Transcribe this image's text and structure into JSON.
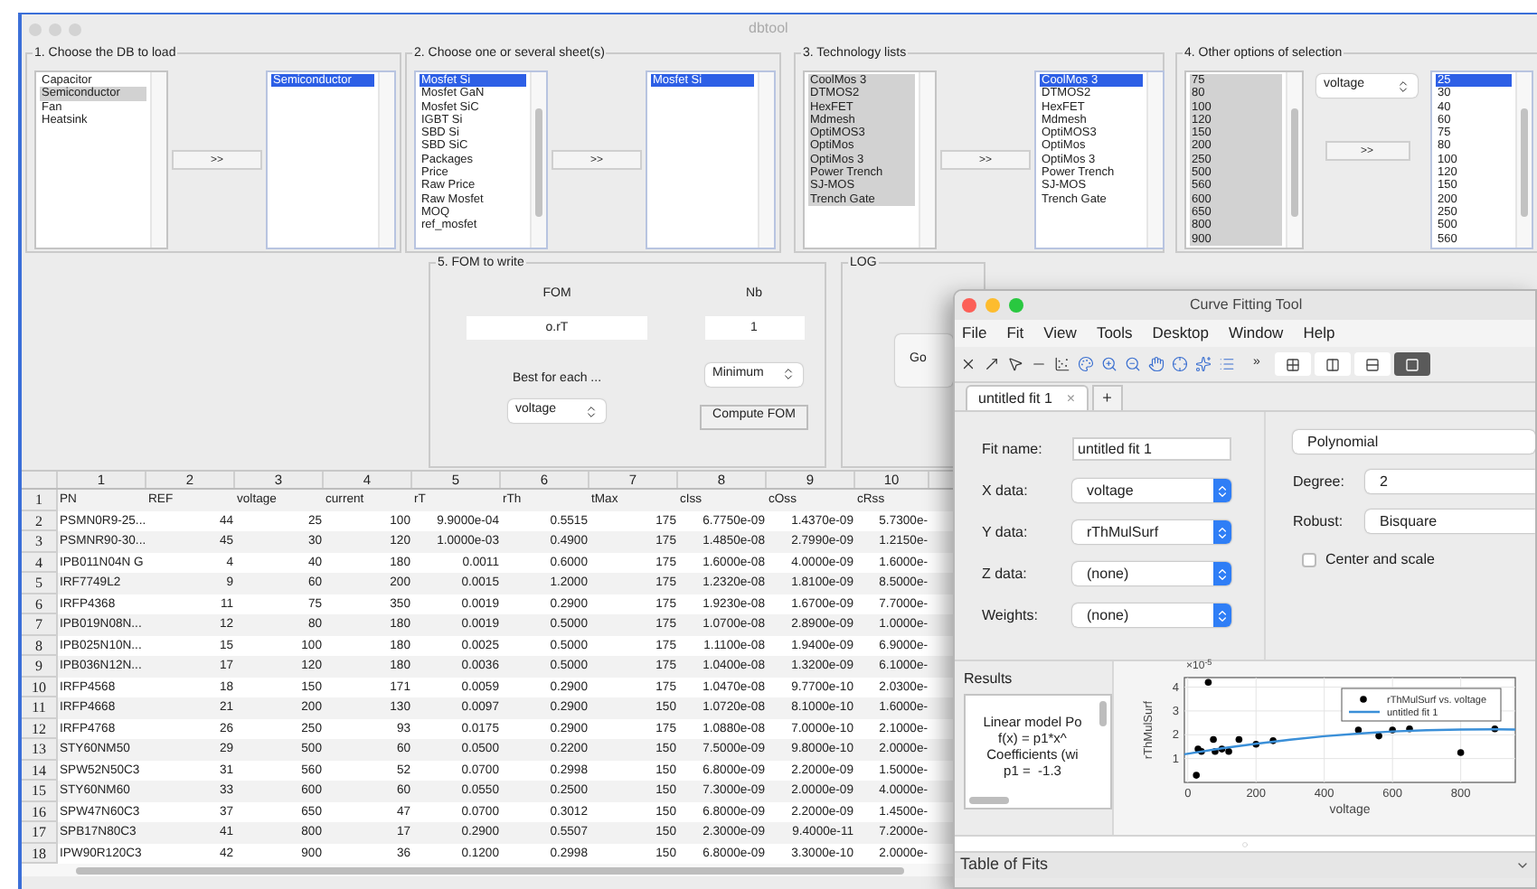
{
  "main_window": {
    "title": "dbtool"
  },
  "panels": [
    {
      "title": "1. Choose the DB to load",
      "move_button": ">>",
      "source": {
        "active": false,
        "items": [
          {
            "label": "Capacitor",
            "selected": false
          },
          {
            "label": "Semiconductor",
            "selected": true
          },
          {
            "label": "Fan",
            "selected": false
          },
          {
            "label": "Heatsink",
            "selected": false
          }
        ]
      },
      "target": {
        "active": true,
        "items": [
          {
            "label": "Semiconductor",
            "selected": true
          }
        ]
      }
    },
    {
      "title": "2. Choose one or several sheet(s)",
      "move_button": ">>",
      "source": {
        "active": true,
        "items": [
          {
            "label": "Mosfet Si",
            "selected": true
          },
          {
            "label": "Mosfet GaN",
            "selected": false
          },
          {
            "label": "Mosfet SiC",
            "selected": false
          },
          {
            "label": "IGBT Si",
            "selected": false
          },
          {
            "label": "SBD Si",
            "selected": false
          },
          {
            "label": "SBD SiC",
            "selected": false
          },
          {
            "label": "Packages",
            "selected": false
          },
          {
            "label": "Price",
            "selected": false
          },
          {
            "label": "Raw Price",
            "selected": false
          },
          {
            "label": "Raw Mosfet",
            "selected": false
          },
          {
            "label": "MOQ",
            "selected": false
          },
          {
            "label": "ref_mosfet",
            "selected": false
          }
        ]
      },
      "target": {
        "active": true,
        "items": [
          {
            "label": "Mosfet Si",
            "selected": true
          }
        ]
      }
    },
    {
      "title": "3. Technology lists",
      "move_button": ">>",
      "source": {
        "active": false,
        "items": [
          {
            "label": "CoolMos 3",
            "selected": true
          },
          {
            "label": "DTMOS2",
            "selected": true
          },
          {
            "label": "HexFET",
            "selected": true
          },
          {
            "label": "Mdmesh",
            "selected": true
          },
          {
            "label": "OptiMOS3",
            "selected": true
          },
          {
            "label": "OptiMos",
            "selected": true
          },
          {
            "label": "OptiMos 3",
            "selected": true
          },
          {
            "label": "Power Trench",
            "selected": true
          },
          {
            "label": "SJ-MOS",
            "selected": true
          },
          {
            "label": "Trench Gate",
            "selected": true
          }
        ]
      },
      "target": {
        "active": true,
        "items": [
          {
            "label": "CoolMos 3",
            "selected": true
          },
          {
            "label": "DTMOS2",
            "selected": false
          },
          {
            "label": "HexFET",
            "selected": false
          },
          {
            "label": "Mdmesh",
            "selected": false
          },
          {
            "label": "OptiMOS3",
            "selected": false
          },
          {
            "label": "OptiMos",
            "selected": false
          },
          {
            "label": "OptiMos 3",
            "selected": false
          },
          {
            "label": "Power Trench",
            "selected": false
          },
          {
            "label": "SJ-MOS",
            "selected": false
          },
          {
            "label": "Trench Gate",
            "selected": false
          }
        ]
      }
    },
    {
      "title": "4. Other options of selection",
      "move_button": ">>",
      "popup": "voltage",
      "source": {
        "active": false,
        "items": [
          {
            "label": "75",
            "selected": true
          },
          {
            "label": "80",
            "selected": true
          },
          {
            "label": "100",
            "selected": true
          },
          {
            "label": "120",
            "selected": true
          },
          {
            "label": "150",
            "selected": true
          },
          {
            "label": "200",
            "selected": true
          },
          {
            "label": "250",
            "selected": true
          },
          {
            "label": "500",
            "selected": true
          },
          {
            "label": "560",
            "selected": true
          },
          {
            "label": "600",
            "selected": true
          },
          {
            "label": "650",
            "selected": true
          },
          {
            "label": "800",
            "selected": true
          },
          {
            "label": "900",
            "selected": true
          }
        ]
      },
      "target": {
        "active": true,
        "items": [
          {
            "label": "25",
            "selected": true
          },
          {
            "label": "30",
            "selected": false
          },
          {
            "label": "40",
            "selected": false
          },
          {
            "label": "60",
            "selected": false
          },
          {
            "label": "75",
            "selected": false
          },
          {
            "label": "80",
            "selected": false
          },
          {
            "label": "100",
            "selected": false
          },
          {
            "label": "120",
            "selected": false
          },
          {
            "label": "150",
            "selected": false
          },
          {
            "label": "200",
            "selected": false
          },
          {
            "label": "250",
            "selected": false
          },
          {
            "label": "500",
            "selected": false
          },
          {
            "label": "560",
            "selected": false
          }
        ]
      }
    }
  ],
  "fom_panel": {
    "title": "5. FOM to write",
    "fom_label": "FOM",
    "fom_value": "o.rT",
    "nb_label": "Nb",
    "nb_value": "1",
    "best_label": "Best for each ...",
    "best_popup": "voltage",
    "mode_popup": "Minimum",
    "compute_button": "Compute FOM"
  },
  "log_panel": {
    "title": "LOG",
    "button": "Go"
  },
  "table": {
    "columns": [
      "1",
      "2",
      "3",
      "4",
      "5",
      "6",
      "7",
      "8",
      "9",
      "10"
    ],
    "rows": [
      {
        "num": "1",
        "cells": [
          "PN",
          "REF",
          "voltage",
          "current",
          "rT",
          "rTh",
          "tMax",
          "cIss",
          "cOss",
          "cRss"
        ]
      },
      {
        "num": "2",
        "cells": [
          "PSMN0R9-25...",
          "44",
          "25",
          "100",
          "9.9000e-04",
          "0.5515",
          "175",
          "6.7750e-09",
          "1.4370e-09",
          "5.7300e-"
        ]
      },
      {
        "num": "3",
        "cells": [
          "PSMNR90-30...",
          "45",
          "30",
          "120",
          "1.0000e-03",
          "0.4900",
          "175",
          "1.4850e-08",
          "2.7990e-09",
          "1.2150e-"
        ]
      },
      {
        "num": "4",
        "cells": [
          "IPB011N04N G",
          "4",
          "40",
          "180",
          "0.0011",
          "0.6000",
          "175",
          "1.6000e-08",
          "4.0000e-09",
          "1.6000e-"
        ]
      },
      {
        "num": "5",
        "cells": [
          "IRF7749L2",
          "9",
          "60",
          "200",
          "0.0015",
          "1.2000",
          "175",
          "1.2320e-08",
          "1.8100e-09",
          "8.5000e-"
        ]
      },
      {
        "num": "6",
        "cells": [
          "IRFP4368",
          "11",
          "75",
          "350",
          "0.0019",
          "0.2900",
          "175",
          "1.9230e-08",
          "1.6700e-09",
          "7.7000e-"
        ]
      },
      {
        "num": "7",
        "cells": [
          "IPB019N08N...",
          "12",
          "80",
          "180",
          "0.0019",
          "0.5000",
          "175",
          "1.0700e-08",
          "2.8900e-09",
          "1.0000e-"
        ]
      },
      {
        "num": "8",
        "cells": [
          "IPB025N10N...",
          "15",
          "100",
          "180",
          "0.0025",
          "0.5000",
          "175",
          "1.1100e-08",
          "1.9400e-09",
          "6.9000e-"
        ]
      },
      {
        "num": "9",
        "cells": [
          "IPB036N12N...",
          "17",
          "120",
          "180",
          "0.0036",
          "0.5000",
          "175",
          "1.0400e-08",
          "1.3200e-09",
          "6.1000e-"
        ]
      },
      {
        "num": "10",
        "cells": [
          "IRFP4568",
          "18",
          "150",
          "171",
          "0.0059",
          "0.2900",
          "175",
          "1.0470e-08",
          "9.7700e-10",
          "2.0300e-"
        ]
      },
      {
        "num": "11",
        "cells": [
          "IRFP4668",
          "21",
          "200",
          "130",
          "0.0097",
          "0.2900",
          "150",
          "1.0720e-08",
          "8.1000e-10",
          "1.6000e-"
        ]
      },
      {
        "num": "12",
        "cells": [
          "IRFP4768",
          "26",
          "250",
          "93",
          "0.0175",
          "0.2900",
          "175",
          "1.0880e-08",
          "7.0000e-10",
          "2.1000e-"
        ]
      },
      {
        "num": "13",
        "cells": [
          "STY60NM50",
          "29",
          "500",
          "60",
          "0.0500",
          "0.2200",
          "150",
          "7.5000e-09",
          "9.8000e-10",
          "2.0000e-"
        ]
      },
      {
        "num": "14",
        "cells": [
          "SPW52N50C3",
          "31",
          "560",
          "52",
          "0.0700",
          "0.2998",
          "150",
          "6.8000e-09",
          "2.2000e-09",
          "1.5000e-"
        ]
      },
      {
        "num": "15",
        "cells": [
          "STY60NM60",
          "33",
          "600",
          "60",
          "0.0550",
          "0.2500",
          "150",
          "7.3000e-09",
          "2.0000e-09",
          "4.0000e-"
        ]
      },
      {
        "num": "16",
        "cells": [
          "SPW47N60C3",
          "37",
          "650",
          "47",
          "0.0700",
          "0.3012",
          "150",
          "6.8000e-09",
          "2.2000e-09",
          "1.4500e-"
        ]
      },
      {
        "num": "17",
        "cells": [
          "SPB17N80C3",
          "41",
          "800",
          "17",
          "0.2900",
          "0.5507",
          "150",
          "2.3000e-09",
          "9.4000e-11",
          "7.2000e-"
        ]
      },
      {
        "num": "18",
        "cells": [
          "IPW90R120C3",
          "42",
          "900",
          "36",
          "0.1200",
          "0.2998",
          "150",
          "6.8000e-09",
          "3.3000e-10",
          "2.0000e-"
        ]
      }
    ]
  },
  "cft": {
    "title": "Curve Fitting Tool",
    "menu": [
      "File",
      "Fit",
      "View",
      "Tools",
      "Desktop",
      "Window",
      "Help"
    ],
    "toolbar_more": "»",
    "layout_buttons": [
      {
        "kind": "grid",
        "selected": false
      },
      {
        "kind": "columns",
        "selected": false
      },
      {
        "kind": "rows",
        "selected": false
      },
      {
        "kind": "single",
        "selected": true
      }
    ],
    "tabs": [
      {
        "label": "untitled fit 1",
        "close": "×",
        "selected": true
      }
    ],
    "add_tab": "+",
    "fit_name_label": "Fit name:",
    "fit_name": "untitled fit 1",
    "data_selects": [
      {
        "label": "X data:",
        "value": "voltage"
      },
      {
        "label": "Y data:",
        "value": "rThMulSurf"
      },
      {
        "label": "Z data:",
        "value": "(none)"
      },
      {
        "label": "Weights:",
        "value": "(none)"
      }
    ],
    "fit_type": "Polynomial",
    "degree_label": "Degree:",
    "degree": "2",
    "robust_label": "Robust:",
    "robust": "Bisquare",
    "center_scale": {
      "label": "Center and scale",
      "checked": false
    },
    "results": {
      "title": "Results",
      "lines": [
        "Linear model Po",
        "f(x) = p1*x^",
        "Coefficients (wi",
        "p1 =  -1.3"
      ]
    },
    "chart_data": {
      "type": "scatter",
      "xlabel": "voltage",
      "ylabel": "rThMulSurf",
      "annotations": [
        {
          "text": "×10$^{-5}$"
        }
      ],
      "grid": true,
      "legend": "upper right",
      "xlim": [
        -10,
        960
      ],
      "ylim": [
        0,
        4.4
      ],
      "xticks": [
        0,
        200,
        400,
        600,
        800
      ],
      "yticks": [
        1,
        2,
        3,
        4
      ],
      "series": [
        {
          "name": "rThMulSurf vs. voltage",
          "color": "#000000",
          "x": [
            25,
            30,
            40,
            60,
            75,
            80,
            100,
            120,
            150,
            200,
            250,
            500,
            560,
            600,
            650,
            800,
            900
          ],
          "values": [
            0.3,
            1.4,
            1.3,
            4.2,
            1.8,
            1.3,
            1.4,
            1.3,
            1.8,
            1.6,
            1.75,
            2.2,
            1.95,
            2.2,
            2.25,
            1.25,
            2.25
          ]
        },
        {
          "name": "untitled fit 1",
          "color": "#3a8fd8",
          "type": "line",
          "x": [
            -10,
            100,
            200,
            300,
            400,
            500,
            600,
            700,
            800,
            900,
            960
          ],
          "values": [
            1.18,
            1.43,
            1.62,
            1.79,
            1.94,
            2.05,
            2.14,
            2.19,
            2.22,
            2.23,
            2.22
          ]
        }
      ]
    },
    "table_of_fits": {
      "title": "Table of Fits"
    }
  }
}
